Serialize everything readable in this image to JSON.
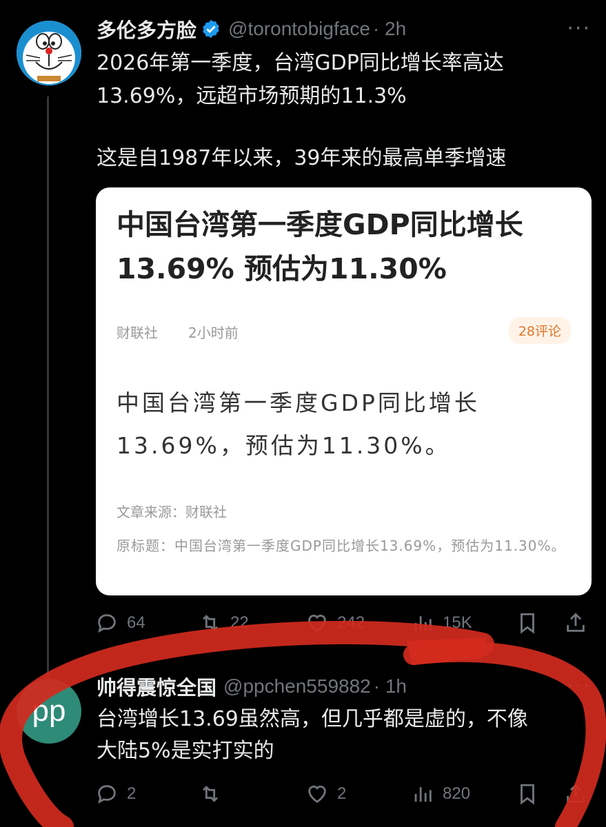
{
  "tweet1": {
    "name": "多伦多方脸",
    "handle": "@torontobigface",
    "time": "· 2h",
    "text_line1": "2026年第一季度，台湾GDP同比增长率高达",
    "text_line2": "13.69%，远超市场预期的11.3%",
    "text_line3": "这是自1987年以来，39年来的最高单季增速",
    "card": {
      "title": "中国台湾第一季度GDP同比增长13.69% 预估为11.30%",
      "source": "财联社",
      "time": "2小时前",
      "comments": "28评论",
      "body": "中国台湾第一季度GDP同比增长13.69%，预估为11.30%。",
      "origin_label": "文章来源：财联社",
      "origin_title": "原标题：中国台湾第一季度GDP同比增长13.69%，预估为11.30%。"
    },
    "actions": {
      "replies": "64",
      "retweets": "22",
      "likes": "242",
      "views": "15K"
    }
  },
  "tweet2": {
    "avatar_text": "pp",
    "name": "帅得震惊全国",
    "handle": "@ppchen559882",
    "time": "· 1h",
    "text_line1": "台湾增长13.69虽然高，但几乎都是虚的，不像",
    "text_line2": "大陆5%是实打实的",
    "actions": {
      "replies": "2",
      "retweets": "",
      "likes": "2",
      "views": "820"
    }
  },
  "more_icon_text": "···",
  "colors": {
    "background": "#000000",
    "text": "#e7e9ea",
    "muted": "#71767b",
    "verified": "#1d9bf0",
    "annotation": "#d32a1e"
  }
}
